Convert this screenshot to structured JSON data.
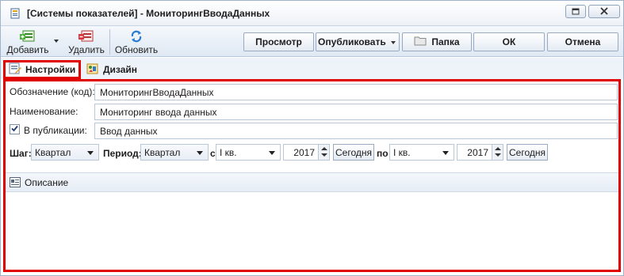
{
  "window": {
    "title": "[Системы показателей] - МониторингВводаДанных"
  },
  "toolbar": {
    "add_label": "Добавить",
    "delete_label": "Удалить",
    "refresh_label": "Обновить",
    "view_label": "Просмотр",
    "publish_label": "Опубликовать",
    "folder_label": "Папка",
    "ok_label": "ОК",
    "cancel_label": "Отмена"
  },
  "tabs": [
    {
      "label": "Настройки",
      "active": true
    },
    {
      "label": "Дизайн",
      "active": false
    }
  ],
  "form": {
    "code_label": "Обозначение (код):",
    "code_value": "МониторингВводаДанных",
    "name_label": "Наименование:",
    "name_value": "Мониторинг ввода данных",
    "publication_label": "В публикации:",
    "publication_checked": true,
    "publication_value": "Ввод данных"
  },
  "period_row": {
    "step_label": "Шаг:",
    "step_value": "Квартал",
    "period_label": "Период:",
    "period_value": "Квартал",
    "from_label": "с",
    "from_quarter": "I кв.",
    "from_year": "2017",
    "today_label": "Сегодня",
    "to_label": "по",
    "to_quarter": "I кв.",
    "to_year": "2017",
    "today_label_2": "Сегодня"
  },
  "description": {
    "label": "Описание"
  },
  "colors": {
    "highlight_border": "#e00000",
    "toolbar_bg": "#dfe8f3"
  },
  "icons": [
    "app-icon",
    "add-icon",
    "delete-icon",
    "refresh-icon",
    "folder-icon",
    "settings-tab-icon",
    "design-tab-icon",
    "checkmark-icon",
    "description-icon"
  ]
}
